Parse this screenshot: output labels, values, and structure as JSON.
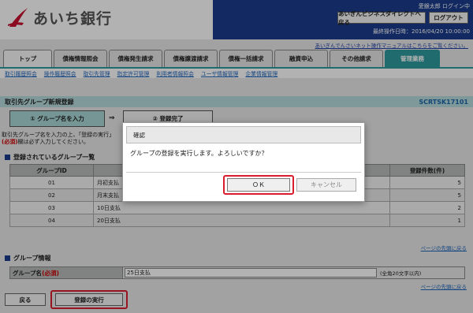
{
  "header": {
    "bank_name": "あいち銀行",
    "user_status": "愛銀太郎 ログイン中",
    "direct_button": "あいぎんビジネスダイレクトへ戻る",
    "logout_button": "ログアウト",
    "last_operation": "最終操作日時：2016/04/20 10:00:00",
    "manual_link": "あいぎんでんさいネット操作マニュアルはこちらをご覧ください。",
    "brand_color": "#1a3c8c",
    "accent_color": "#2e9a9c"
  },
  "tabs": [
    {
      "label": "トップ"
    },
    {
      "label": "債権情報照会"
    },
    {
      "label": "債権発生請求"
    },
    {
      "label": "債権譲渡請求"
    },
    {
      "label": "債権一括請求"
    },
    {
      "label": "融資申込"
    },
    {
      "label": "その他請求"
    },
    {
      "label": "管理業務",
      "active": true
    }
  ],
  "subnav": [
    "取引履歴照会",
    "操作履歴照会",
    "取引先管理",
    "指定許可管理",
    "利用者情報照会",
    "ユーザ情報管理",
    "企業情報管理"
  ],
  "page": {
    "title": "取引先グループ新規登録",
    "screen_code": "SCRTSK17101",
    "step1": "① グループ名を入力",
    "step_arrow": "⇒",
    "step2": "② 登録完了",
    "desc_line1": "取引先グループ名を入力の上、「登録の実行」",
    "desc_req": "(必須)",
    "desc_line2": "欄は必ず入力してください。"
  },
  "registered_groups": {
    "section_title": "登録されているグループ一覧",
    "col_id": "グループID",
    "col_name": "",
    "col_count": "登録件数(件)",
    "rows": [
      {
        "id": "01",
        "name": "月初支払",
        "count": "5"
      },
      {
        "id": "02",
        "name": "月末支払",
        "count": "5"
      },
      {
        "id": "03",
        "name": "10日支払",
        "count": "2"
      },
      {
        "id": "04",
        "name": "20日支払",
        "count": "1"
      }
    ]
  },
  "to_top_link": "ページの先頭に戻る",
  "group_info": {
    "section_title": "グループ情報",
    "label": "グループ名",
    "required": "(必須)",
    "value": "25日支払",
    "note": "(全角20文字以内)"
  },
  "buttons": {
    "back": "戻る",
    "register": "登録の実行"
  },
  "dialog": {
    "title": "確認",
    "message": "グループの登録を実行します。よろしいですか？",
    "ok": "ＯＫ",
    "cancel": "キャンセル"
  }
}
